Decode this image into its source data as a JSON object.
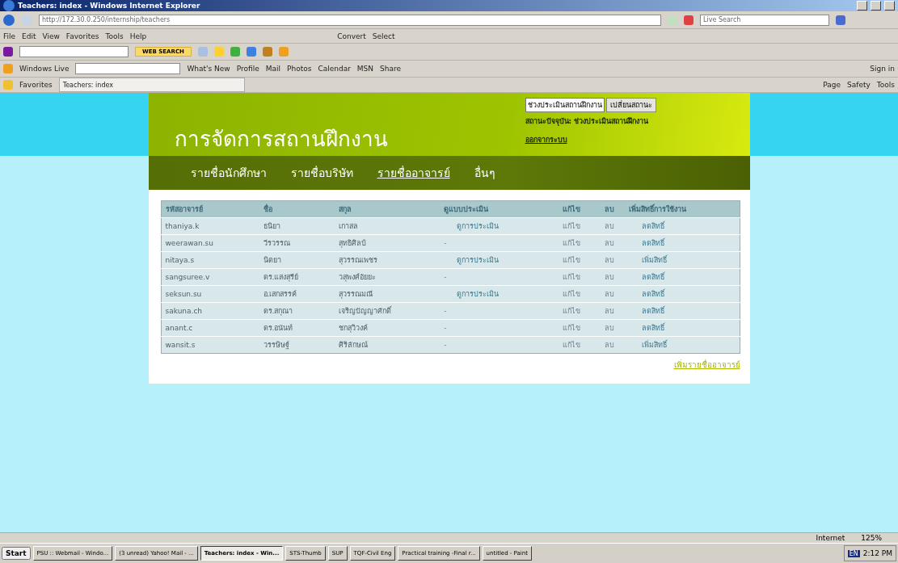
{
  "window": {
    "title": "Teachers: index - Windows Internet Explorer",
    "address": "http://172.30.0.250/internship/teachers",
    "search_placeholder": "Live Search"
  },
  "menu": [
    "File",
    "Edit",
    "View",
    "Favorites",
    "Tools",
    "Help"
  ],
  "menu_extras": [
    "Convert",
    "Select"
  ],
  "yahoo_toolbar": {
    "search_button": "WEB SEARCH"
  },
  "live_toolbar": {
    "label": "Windows Live",
    "links": [
      "What's New",
      "Profile",
      "Mail",
      "Photos",
      "Calendar",
      "MSN",
      "Share"
    ],
    "sign_in": "Sign in"
  },
  "favorites_bar": {
    "label": "Favorites",
    "tab": "Teachers: index",
    "commands": [
      "Page",
      "Safety",
      "Tools"
    ]
  },
  "page": {
    "title": "การจัดการสถานฝึกงาน",
    "status_select": "ช่วงประเมินสถานฝึกงาน",
    "status_button": "เปลี่ยนสถานะ",
    "current_status": "สถานะปัจจุบัน: ช่วงประเมินสถานฝึกงาน",
    "logout": "ออกจากระบบ",
    "nav": [
      {
        "label": "รายชื่อนักศึกษา",
        "selected": false
      },
      {
        "label": "รายชื่อบริษัท",
        "selected": false
      },
      {
        "label": "รายชื่ออาจารย์",
        "selected": true
      },
      {
        "label": "อื่นๆ",
        "selected": false
      }
    ],
    "table": {
      "columns": [
        "รหัสอาจารย์",
        "ชื่อ",
        "สกุล",
        "ดูแบบประเมิน",
        "แก้ไข",
        "ลบ",
        "เพิ่มสิทธิ์การใช้งาน"
      ],
      "rows": [
        {
          "id": "thaniya.k",
          "first": "ธนิยา",
          "last": "เกาสล",
          "evaluation": "ดูการประเมิน",
          "eval_link": true,
          "edit": "แก้ไข",
          "delete": "ลบ",
          "rights": "ลดสิทธิ์"
        },
        {
          "id": "weerawan.su",
          "first": "วีรวรรณ",
          "last": "สุทธิศิลป์",
          "evaluation": "-",
          "eval_link": false,
          "edit": "แก้ไข",
          "delete": "ลบ",
          "rights": "ลดสิทธิ์"
        },
        {
          "id": "nitaya.s",
          "first": "นิตยา",
          "last": "สุวรรณเพชร",
          "evaluation": "ดูการประเมิน",
          "eval_link": true,
          "edit": "แก้ไข",
          "delete": "ลบ",
          "rights": "เพิ่มสิทธิ์"
        },
        {
          "id": "sangsuree.v",
          "first": "ดร.แสงสุรีย์",
          "last": "วสุพงศ์อัยยะ",
          "evaluation": "-",
          "eval_link": false,
          "edit": "แก้ไข",
          "delete": "ลบ",
          "rights": "ลดสิทธิ์"
        },
        {
          "id": "seksun.su",
          "first": "อ.เสกสรรค์",
          "last": "สุวรรณมณี",
          "evaluation": "ดูการประเมิน",
          "eval_link": true,
          "edit": "แก้ไข",
          "delete": "ลบ",
          "rights": "ลดสิทธิ์"
        },
        {
          "id": "sakuna.ch",
          "first": "ดร.สกุณา",
          "last": "เจริญปัญญาศักดิ์",
          "evaluation": "-",
          "eval_link": false,
          "edit": "แก้ไข",
          "delete": "ลบ",
          "rights": "ลดสิทธิ์"
        },
        {
          "id": "anant.c",
          "first": "ดร.อนันท์",
          "last": "ชกสุวิวงค์",
          "evaluation": "-",
          "eval_link": false,
          "edit": "แก้ไข",
          "delete": "ลบ",
          "rights": "ลดสิทธิ์"
        },
        {
          "id": "wansit.s",
          "first": "วรรษิษฐ์",
          "last": "ศิริลักษณ์",
          "evaluation": "-",
          "eval_link": false,
          "edit": "แก้ไข",
          "delete": "ลบ",
          "rights": "เพิ่มสิทธิ์"
        }
      ]
    },
    "add_link": "เพิ่มรายชื่ออาจารย์"
  },
  "status_bar": {
    "zone": "Internet",
    "zoom": "125%"
  },
  "taskbar": {
    "start": "Start",
    "items": [
      {
        "label": "PSU :: Webmail - Windo...",
        "selected": false
      },
      {
        "label": "(3 unread) Yahoo! Mail - ...",
        "selected": false
      },
      {
        "label": "Teachers: index - Win...",
        "selected": true
      },
      {
        "label": "STS-Thumb",
        "selected": false
      },
      {
        "label": "SUP",
        "selected": false
      },
      {
        "label": "TQF-Civil Eng",
        "selected": false
      },
      {
        "label": "Practical training -Final r...",
        "selected": false
      },
      {
        "label": "untitled - Paint",
        "selected": false
      }
    ],
    "language": "EN",
    "clock": "2:12 PM"
  }
}
